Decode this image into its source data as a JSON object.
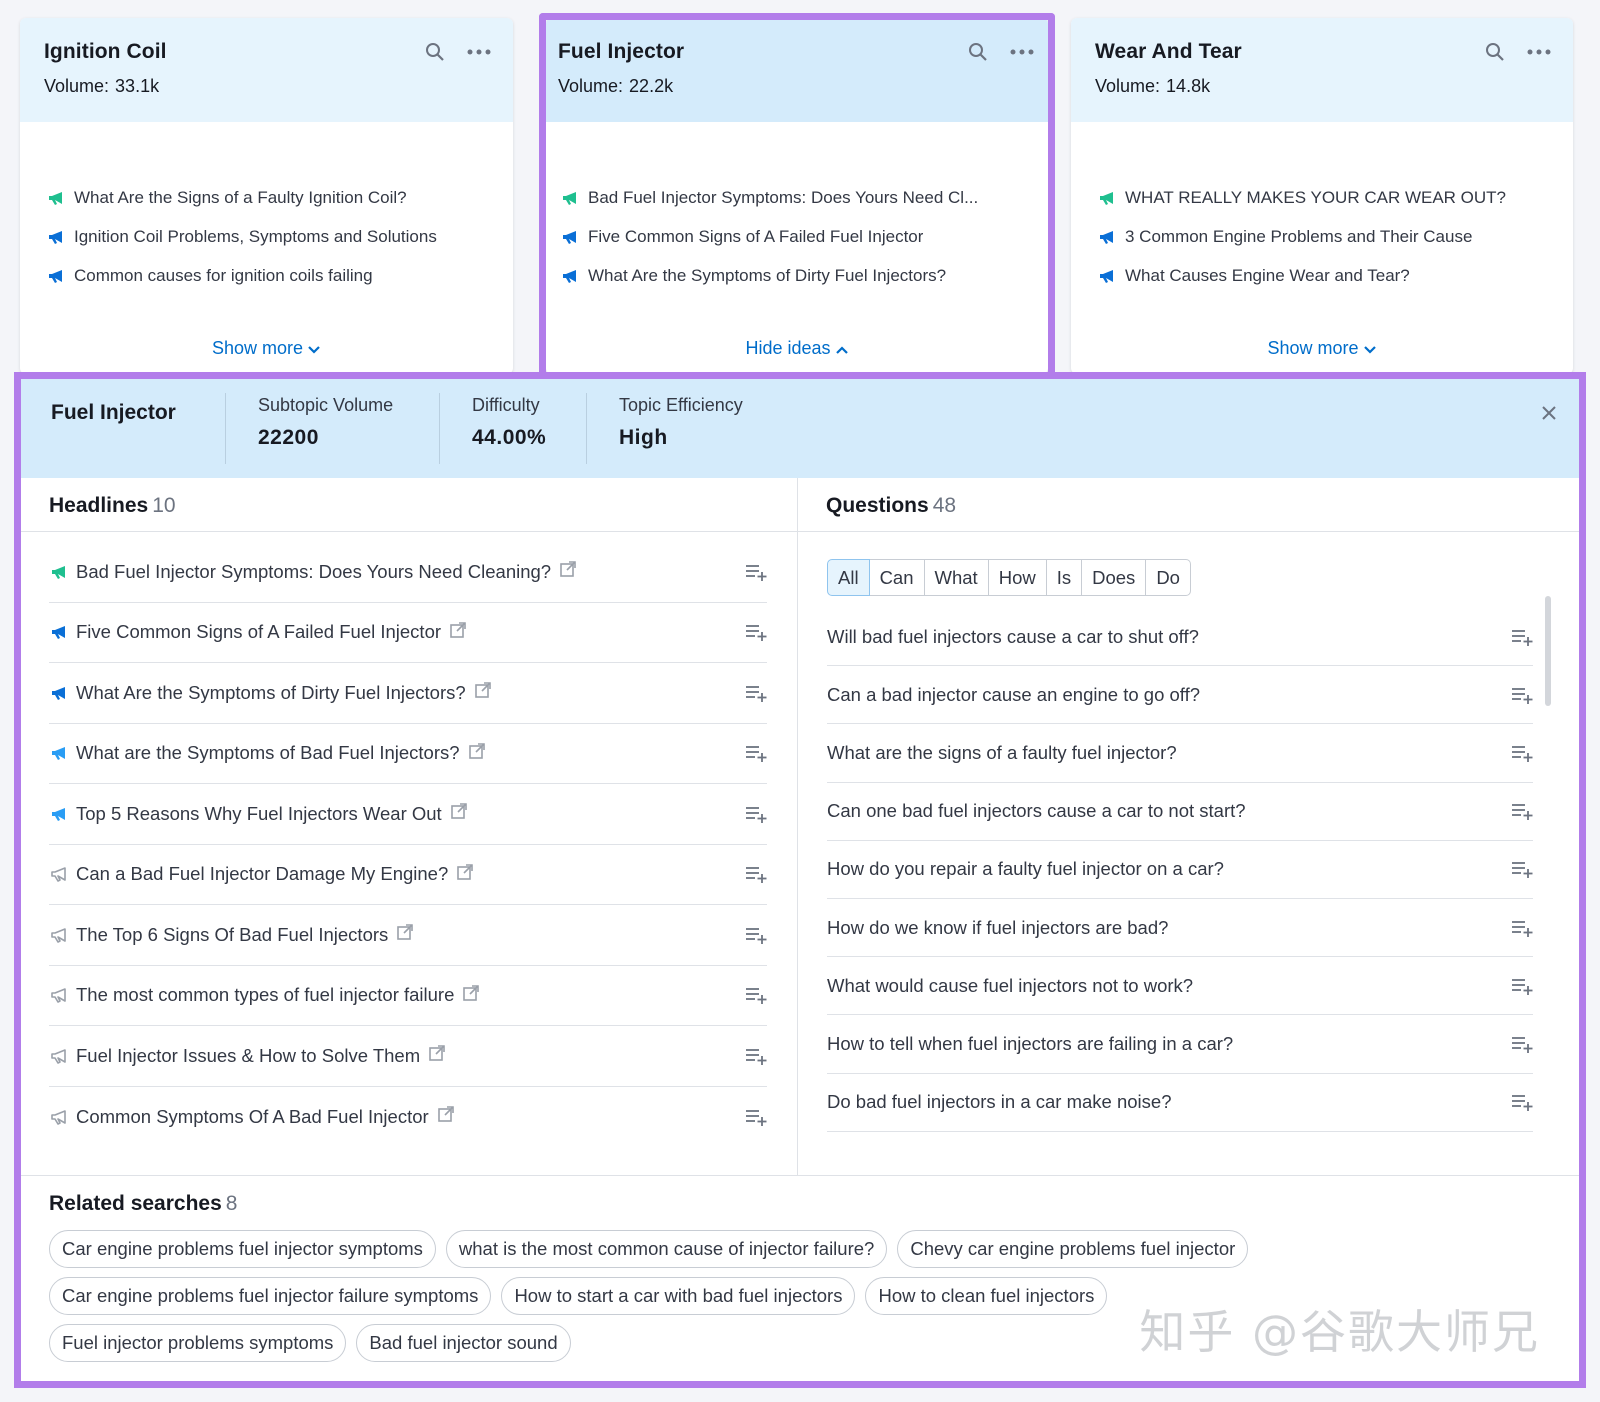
{
  "colors": {
    "accent_outline": "#b27dea",
    "link": "#006dca",
    "card_head": "#e6f4fd",
    "selected_head": "#d4ebfb",
    "icon_green": "#1fbf8f",
    "icon_blue": "#0a6fd6",
    "icon_light": "#2a9df4",
    "icon_gray": "#9aa0a9"
  },
  "cards": [
    {
      "title": "Ignition Coil",
      "volume_label": "Volume:",
      "volume": "33.1k",
      "footer": "Show more",
      "items": [
        {
          "text": "What Are the Signs of a Faulty Ignition Coil?",
          "icon": "megaphone-green-icon"
        },
        {
          "text": "Ignition Coil Problems, Symptoms and Solutions",
          "icon": "megaphone-blue-icon"
        },
        {
          "text": "Common causes for ignition coils failing",
          "icon": "megaphone-blue-icon"
        }
      ]
    },
    {
      "title": "Fuel Injector",
      "volume_label": "Volume:",
      "volume": "22.2k",
      "footer": "Hide ideas",
      "items": [
        {
          "text": "Bad Fuel Injector Symptoms: Does Yours Need Cl...",
          "icon": "megaphone-green-icon"
        },
        {
          "text": "Five Common Signs of A Failed Fuel Injector",
          "icon": "megaphone-blue-icon"
        },
        {
          "text": "What Are the Symptoms of Dirty Fuel Injectors?",
          "icon": "megaphone-blue-icon"
        }
      ]
    },
    {
      "title": "Wear And Tear",
      "volume_label": "Volume:",
      "volume": "14.8k",
      "footer": "Show more",
      "items": [
        {
          "text": "WHAT REALLY MAKES YOUR CAR WEAR OUT?",
          "icon": "megaphone-green-icon"
        },
        {
          "text": "3 Common Engine Problems and Their Cause",
          "icon": "megaphone-blue-icon"
        },
        {
          "text": "What Causes Engine Wear and Tear?",
          "icon": "megaphone-blue-icon"
        }
      ]
    }
  ],
  "panel": {
    "title": "Fuel Injector",
    "stats": [
      {
        "label": "Subtopic Volume",
        "value": "22200"
      },
      {
        "label": "Difficulty",
        "value": "44.00%"
      },
      {
        "label": "Topic Efficiency",
        "value": "High"
      }
    ],
    "headlines": {
      "title": "Headlines",
      "count": "10",
      "items": [
        {
          "text": "Bad Fuel Injector Symptoms: Does Yours Need Cleaning?",
          "icon": "megaphone-green-icon"
        },
        {
          "text": "Five Common Signs of A Failed Fuel Injector",
          "icon": "megaphone-blue-icon"
        },
        {
          "text": "What Are the Symptoms of Dirty Fuel Injectors?",
          "icon": "megaphone-blue-icon"
        },
        {
          "text": "What are the Symptoms of Bad Fuel Injectors?",
          "icon": "megaphone-light-icon"
        },
        {
          "text": "Top 5 Reasons Why Fuel Injectors Wear Out",
          "icon": "megaphone-light-icon"
        },
        {
          "text": "Can a Bad Fuel Injector Damage My Engine?",
          "icon": "megaphone-gray-icon"
        },
        {
          "text": "The Top 6 Signs Of Bad Fuel Injectors",
          "icon": "megaphone-gray-icon"
        },
        {
          "text": "The most common types of fuel injector failure",
          "icon": "megaphone-gray-icon"
        },
        {
          "text": "Fuel Injector Issues & How to Solve Them",
          "icon": "megaphone-gray-icon"
        },
        {
          "text": "Common Symptoms Of A Bad Fuel Injector",
          "icon": "megaphone-gray-icon"
        }
      ]
    },
    "questions": {
      "title": "Questions",
      "count": "48",
      "filters": [
        "All",
        "Can",
        "What",
        "How",
        "Is",
        "Does",
        "Do"
      ],
      "items": [
        "Will bad fuel injectors cause a car to shut off?",
        "Can a bad injector cause an engine to go off?",
        "What are the signs of a faulty fuel injector?",
        "Can one bad fuel injectors cause a car to not start?",
        "How do you repair a faulty fuel injector on a car?",
        "How do we know if fuel injectors are bad?",
        "What would cause fuel injectors not to work?",
        "How to tell when fuel injectors are failing in a car?",
        "Do bad fuel injectors in a car make noise?"
      ]
    },
    "related": {
      "title": "Related searches",
      "count": "8",
      "items": [
        "Car engine problems fuel injector symptoms",
        "what is the most common cause of injector failure?",
        "Chevy car engine problems fuel injector",
        "Car engine problems fuel injector failure symptoms",
        "How to start a car with bad fuel injectors",
        "How to clean fuel injectors",
        "Fuel injector problems symptoms",
        "Bad fuel injector sound"
      ]
    }
  },
  "watermark": "知乎 @谷歌大师兄"
}
